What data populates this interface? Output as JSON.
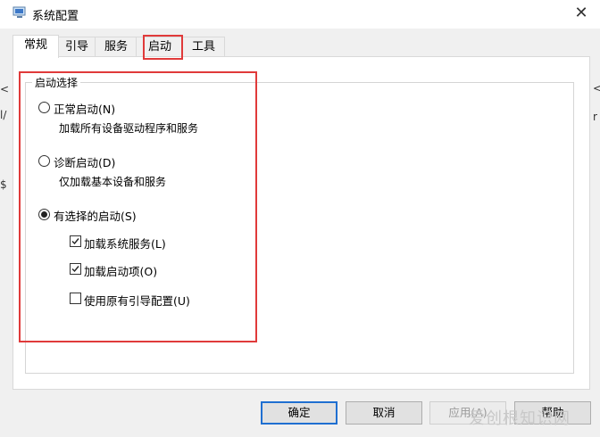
{
  "window": {
    "title": "系统配置",
    "close_glyph": "✕"
  },
  "tabs": [
    {
      "label": "常规",
      "active": true
    },
    {
      "label": "引导",
      "active": false
    },
    {
      "label": "服务",
      "active": false
    },
    {
      "label": "启动",
      "active": false
    },
    {
      "label": "工具",
      "active": false
    }
  ],
  "startup": {
    "group_label": "启动选择",
    "normal": {
      "label": "正常启动(N)",
      "desc": "加载所有设备驱动程序和服务",
      "selected": false
    },
    "diagnostic": {
      "label": "诊断启动(D)",
      "desc": "仅加载基本设备和服务",
      "selected": false
    },
    "selective": {
      "label": "有选择的启动(S)",
      "selected": true,
      "options": [
        {
          "label": "加载系统服务(L)",
          "checked": true
        },
        {
          "label": "加载启动项(O)",
          "checked": true
        },
        {
          "label": "使用原有引导配置(U)",
          "checked": false
        }
      ]
    }
  },
  "buttons": {
    "ok": "确定",
    "cancel": "取消",
    "apply": "应用(A)",
    "help": "帮助"
  },
  "watermark": "爱创根知识网",
  "colors": {
    "annotation": "#e03a3a",
    "default_button_border": "#1f6fd1"
  },
  "icons": {
    "app": "msconfig-icon",
    "close": "close-icon"
  }
}
